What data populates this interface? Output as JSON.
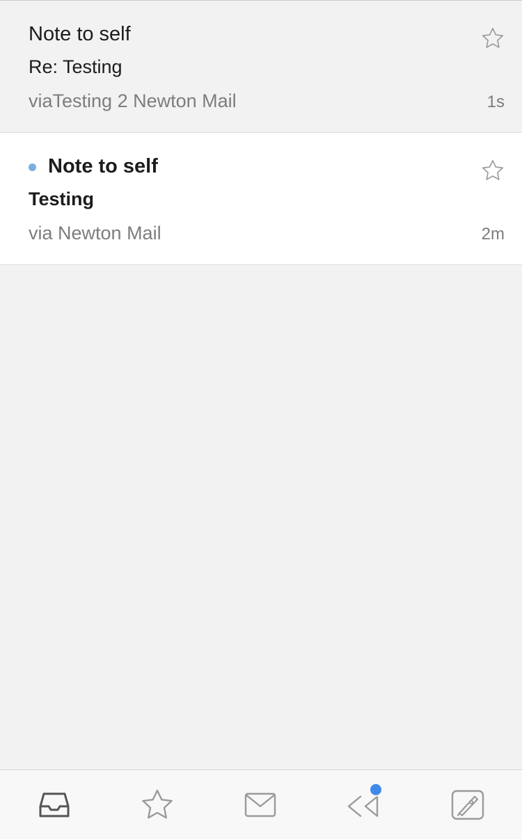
{
  "messages": [
    {
      "sender": "Note to self",
      "subject": "Re: Testing",
      "preview": "viaTesting 2 Newton Mail",
      "time": "1s",
      "unread": false
    },
    {
      "sender": "Note to self",
      "subject": "Testing",
      "preview": "via Newton Mail",
      "time": "2m",
      "unread": true
    }
  ],
  "tabbar": {
    "tabs": [
      {
        "name": "inbox",
        "icon": "inbox-icon",
        "active": true
      },
      {
        "name": "starred",
        "icon": "star-icon",
        "active": false
      },
      {
        "name": "all-mail",
        "icon": "envelope-icon",
        "active": false
      },
      {
        "name": "sent",
        "icon": "reply-all-icon",
        "active": false,
        "has_badge": true
      },
      {
        "name": "compose",
        "icon": "compose-icon",
        "active": false
      }
    ],
    "badge_color": "#3e8ae6"
  },
  "colors": {
    "background": "#f2f2f2",
    "unread_row_background": "#ffffff",
    "unread_dot": "#7aaee0",
    "secondary_text": "#7d7d7d",
    "icon_gray": "#9a9a9a",
    "icon_active": "#555555"
  }
}
